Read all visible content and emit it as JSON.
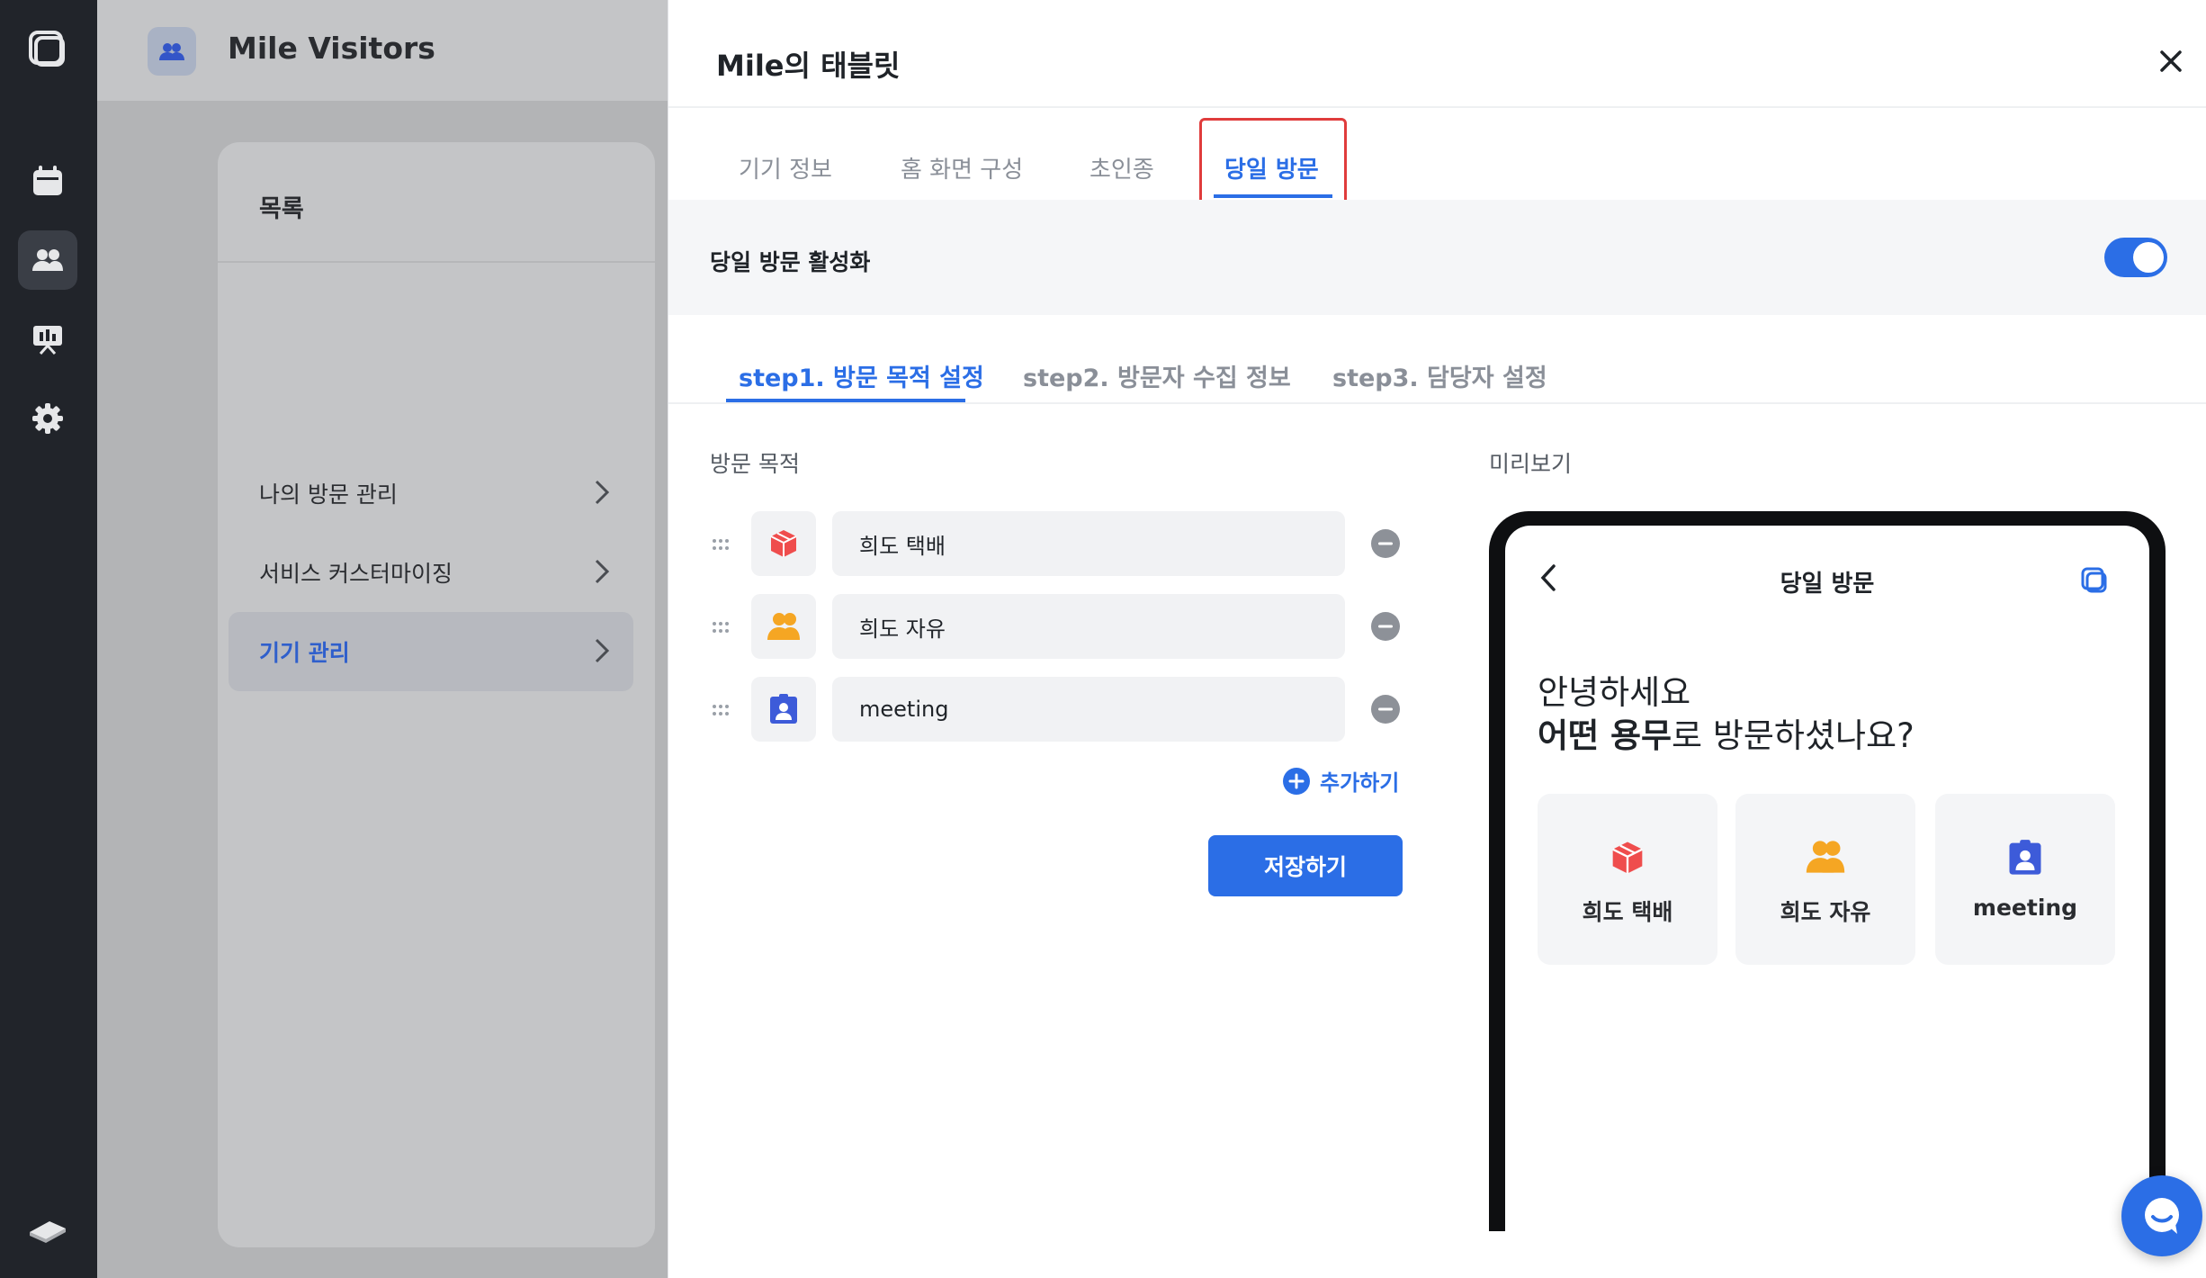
{
  "rail": {
    "icons": [
      "app-logo-icon",
      "calendar-icon",
      "visitors-icon",
      "presentation-icon",
      "settings-icon",
      "book-icon"
    ]
  },
  "backdrop": {
    "app_title": "Mile Visitors",
    "menu_title": "목록",
    "menu_items": [
      {
        "label": "나의 방문 관리"
      },
      {
        "label": "서비스 커스터마이징"
      },
      {
        "label": "기기 관리"
      }
    ]
  },
  "panel": {
    "title": "Mile의 태블릿",
    "tabs": [
      {
        "label": "기기 정보"
      },
      {
        "label": "홈 화면 구성"
      },
      {
        "label": "초인종"
      },
      {
        "label": "당일 방문"
      }
    ],
    "active_tab": "당일 방문",
    "toggle": {
      "label": "당일 방문 활성화",
      "on": true
    },
    "steps": [
      {
        "label": "step1. 방문 목적 설정"
      },
      {
        "label": "step2. 방문자 수집 정보"
      },
      {
        "label": "step3. 담당자 설정"
      }
    ],
    "purpose_label": "방문 목적",
    "purposes": [
      {
        "value": "희도 택배",
        "icon": "package-icon",
        "color": "#ef4d4d"
      },
      {
        "value": "희도 자유",
        "icon": "people-icon",
        "color": "#f5a623"
      },
      {
        "value": "meeting",
        "icon": "badge-icon",
        "color": "#3d5bd9"
      }
    ],
    "add_label": "추가하기",
    "save_label": "저장하기",
    "preview_label": "미리보기"
  },
  "preview": {
    "title": "당일 방문",
    "greeting_line1": "안녕하세요",
    "greeting_bold": "어떤 용무",
    "greeting_rest": "로 방문하셨나요?",
    "cards": [
      {
        "label": "희도 택배"
      },
      {
        "label": "희도 자유"
      },
      {
        "label": "meeting"
      }
    ]
  },
  "colors": {
    "accent": "#2b6ee6",
    "highlight_border": "#e03c3c",
    "rail_bg": "#21242a"
  }
}
